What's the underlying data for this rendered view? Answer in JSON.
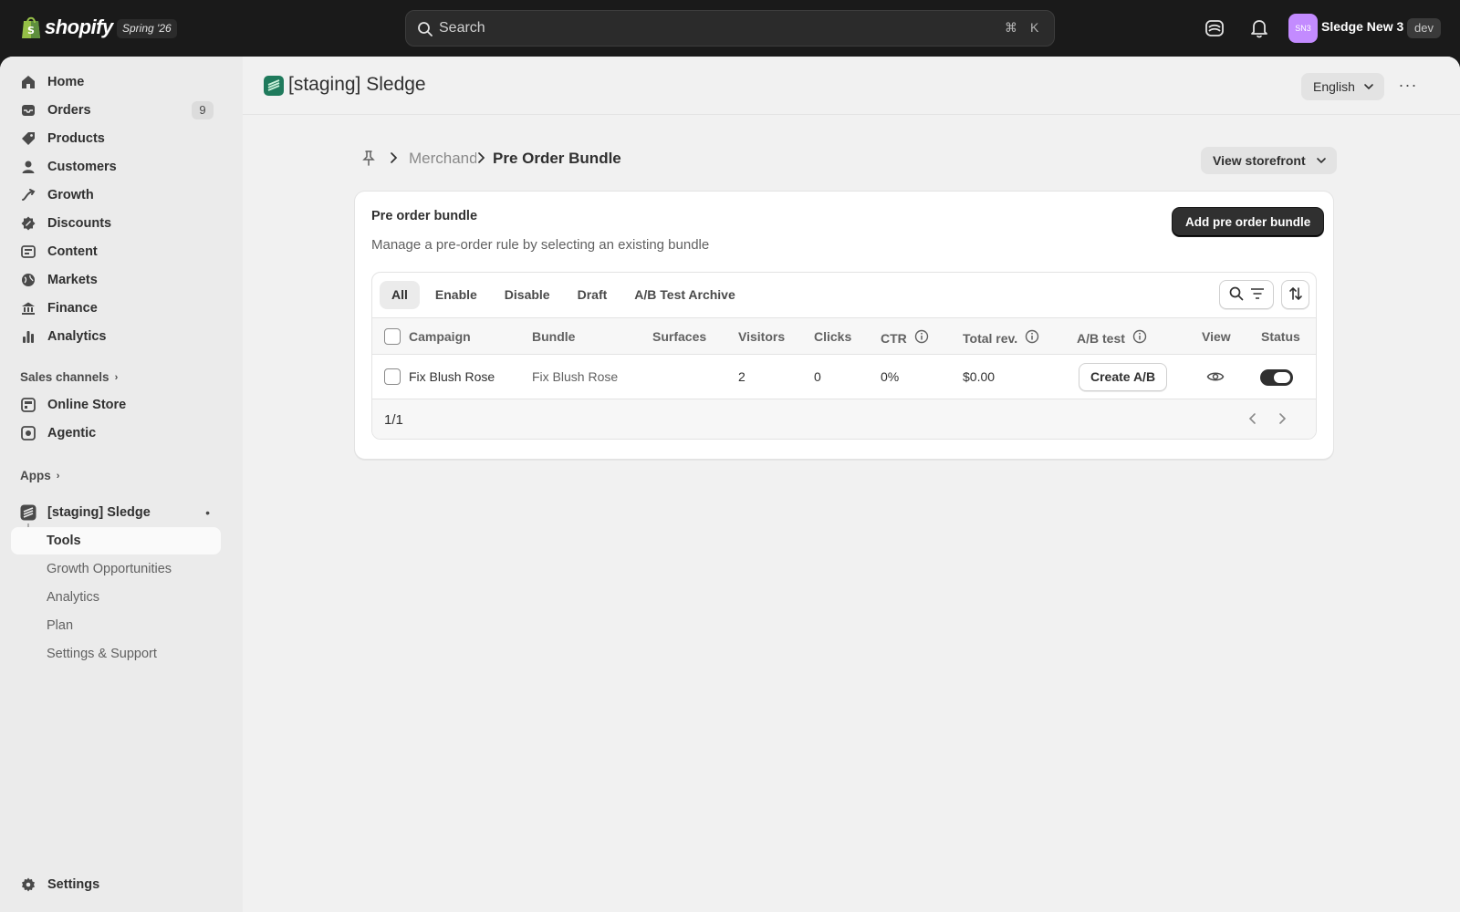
{
  "topbar": {
    "logo_text": "shopify",
    "edition": "Spring '26",
    "search_placeholder": "Search",
    "shortcut_cmd": "⌘",
    "shortcut_key": "K",
    "avatar_initials": "SN3",
    "store_name": "Sledge New 3",
    "badge": "dev"
  },
  "sidebar": {
    "items": [
      {
        "label": "Home",
        "icon": "home-icon"
      },
      {
        "label": "Orders",
        "icon": "inbox-icon",
        "count": "9"
      },
      {
        "label": "Products",
        "icon": "tag-icon"
      },
      {
        "label": "Customers",
        "icon": "person-icon"
      },
      {
        "label": "Growth",
        "icon": "growth-icon"
      },
      {
        "label": "Discounts",
        "icon": "discount-icon"
      },
      {
        "label": "Content",
        "icon": "content-icon"
      },
      {
        "label": "Markets",
        "icon": "globe-icon"
      },
      {
        "label": "Finance",
        "icon": "bank-icon"
      },
      {
        "label": "Analytics",
        "icon": "chart-icon"
      }
    ],
    "sales_channels_label": "Sales channels",
    "channels": [
      {
        "label": "Online Store"
      },
      {
        "label": "Agentic"
      }
    ],
    "apps_label": "Apps",
    "app_name": "[staging] Sledge",
    "app_subitems": [
      {
        "label": "Tools"
      },
      {
        "label": "Growth Opportunities"
      },
      {
        "label": "Analytics"
      },
      {
        "label": "Plan"
      },
      {
        "label": "Settings & Support"
      }
    ],
    "settings_label": "Settings"
  },
  "header": {
    "title": "[staging] Sledge",
    "language": "English"
  },
  "breadcrumb": {
    "parent": "Merchandising",
    "current": "Pre Order Bundle",
    "view_storefront": "View storefront"
  },
  "card": {
    "title": "Pre order bundle",
    "subtitle": "Manage a pre-order rule by selecting an existing bundle",
    "add_button": "Add pre order bundle",
    "tabs": [
      "All",
      "Enable",
      "Disable",
      "Draft",
      "A/B Test Archive"
    ],
    "columns": {
      "campaign": "Campaign",
      "bundle": "Bundle",
      "surfaces": "Surfaces",
      "visitors": "Visitors",
      "clicks": "Clicks",
      "ctr": "CTR",
      "total_rev": "Total rev.",
      "ab_test": "A/B test",
      "view": "View",
      "status": "Status"
    },
    "rows": [
      {
        "campaign": "Fix Blush Rose",
        "bundle": "Fix Blush Rose",
        "surfaces": "",
        "visitors": "2",
        "clicks": "0",
        "ctr": "0%",
        "total_rev": "$0.00",
        "ab_action": "Create A/B",
        "status_on": true
      }
    ],
    "pagination": "1/1"
  }
}
